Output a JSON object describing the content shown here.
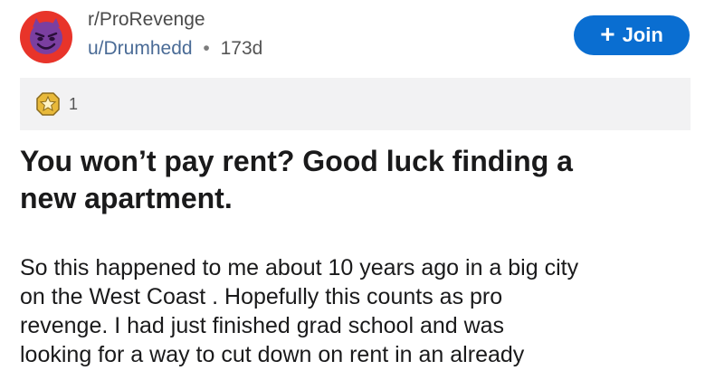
{
  "post": {
    "subreddit": "r/ProRevenge",
    "username": "u/Drumhedd",
    "separator": "•",
    "age": "173d",
    "join_label": "Join",
    "join_icon": "+",
    "award_count": "1",
    "title_line1": "You won’t pay rent? Good luck finding a",
    "title_line2": "new apartment.",
    "body_lines": [
      "So this happened to me about 10 years ago in a big city",
      "on the West Coast . Hopefully this counts as pro",
      "revenge. I had just finished grad school and was",
      "looking for a way to cut down on rent in an already"
    ]
  },
  "colors": {
    "avatar_bg": "#e8342a",
    "avatar_face": "#7b3fa0",
    "join_bg": "#0a6ed1",
    "username": "#4a6b96",
    "award": "#e8b93a"
  },
  "icons": {
    "avatar": "devil-face-icon",
    "award": "star-award-icon"
  }
}
